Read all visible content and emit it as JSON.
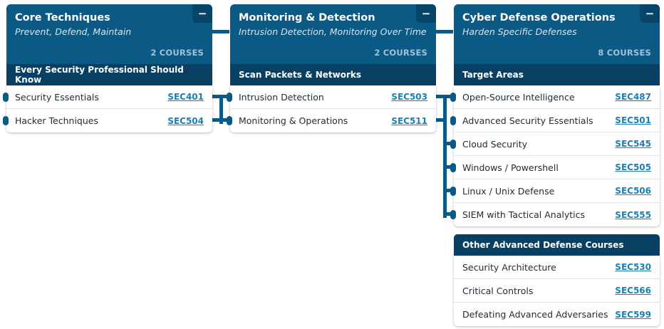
{
  "columns": [
    {
      "title": "Core Techniques",
      "subtitle": "Prevent, Defend, Maintain",
      "count": "2 COURSES",
      "collapse": "−",
      "section": "Every Security Professional Should Know",
      "courses": [
        {
          "name": "Security Essentials",
          "code": "SEC401"
        },
        {
          "name": "Hacker Techniques",
          "code": "SEC504"
        }
      ]
    },
    {
      "title": "Monitoring & Detection",
      "subtitle": "Intrusion Detection, Monitoring Over Time",
      "count": "2 COURSES",
      "collapse": "−",
      "section": "Scan Packets & Networks",
      "courses": [
        {
          "name": "Intrusion Detection",
          "code": "SEC503"
        },
        {
          "name": "Monitoring & Operations",
          "code": "SEC511"
        }
      ]
    },
    {
      "title": "Cyber Defense Operations",
      "subtitle": "Harden Specific Defenses",
      "count": "8 COURSES",
      "collapse": "−",
      "section": "Target Areas",
      "courses": [
        {
          "name": "Open-Source Intelligence",
          "code": "SEC487"
        },
        {
          "name": "Advanced Security Essentials",
          "code": "SEC501"
        },
        {
          "name": "Cloud Security",
          "code": "SEC545"
        },
        {
          "name": "Windows / Powershell",
          "code": "SEC505"
        },
        {
          "name": "Linux / Unix Defense",
          "code": "SEC506"
        },
        {
          "name": "SIEM with Tactical Analytics",
          "code": "SEC555"
        }
      ],
      "section2": "Other Advanced Defense Courses",
      "courses2": [
        {
          "name": "Security Architecture",
          "code": "SEC530"
        },
        {
          "name": "Critical Controls",
          "code": "SEC566"
        },
        {
          "name": "Defeating Advanced Adversaries",
          "code": "SEC599"
        }
      ]
    }
  ]
}
